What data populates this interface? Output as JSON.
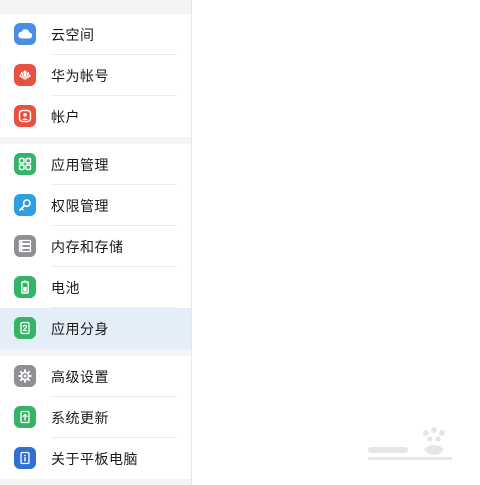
{
  "sidebar": {
    "groups": [
      {
        "items": [
          {
            "label": "云空间",
            "icon": "cloud-icon",
            "color": "#4a8de8"
          },
          {
            "label": "华为帐号",
            "icon": "huawei-logo-icon",
            "color": "#e8503f"
          },
          {
            "label": "帐户",
            "icon": "account-icon",
            "color": "#e8503f"
          }
        ]
      },
      {
        "items": [
          {
            "label": "应用管理",
            "icon": "apps-grid-icon",
            "color": "#35b468"
          },
          {
            "label": "权限管理",
            "icon": "key-icon",
            "color": "#2f9fe0"
          },
          {
            "label": "内存和存储",
            "icon": "storage-icon",
            "color": "#8e9095"
          },
          {
            "label": "电池",
            "icon": "battery-icon",
            "color": "#35b468"
          },
          {
            "label": "应用分身",
            "icon": "app-twin-icon",
            "color": "#35b468"
          }
        ]
      },
      {
        "items": [
          {
            "label": "高级设置",
            "icon": "gear-icon",
            "color": "#8e9095"
          },
          {
            "label": "系统更新",
            "icon": "system-update-icon",
            "color": "#35b468"
          },
          {
            "label": "关于平板电脑",
            "icon": "info-icon",
            "color": "#2f6fd6"
          }
        ]
      }
    ],
    "active_label": "应用分身"
  }
}
